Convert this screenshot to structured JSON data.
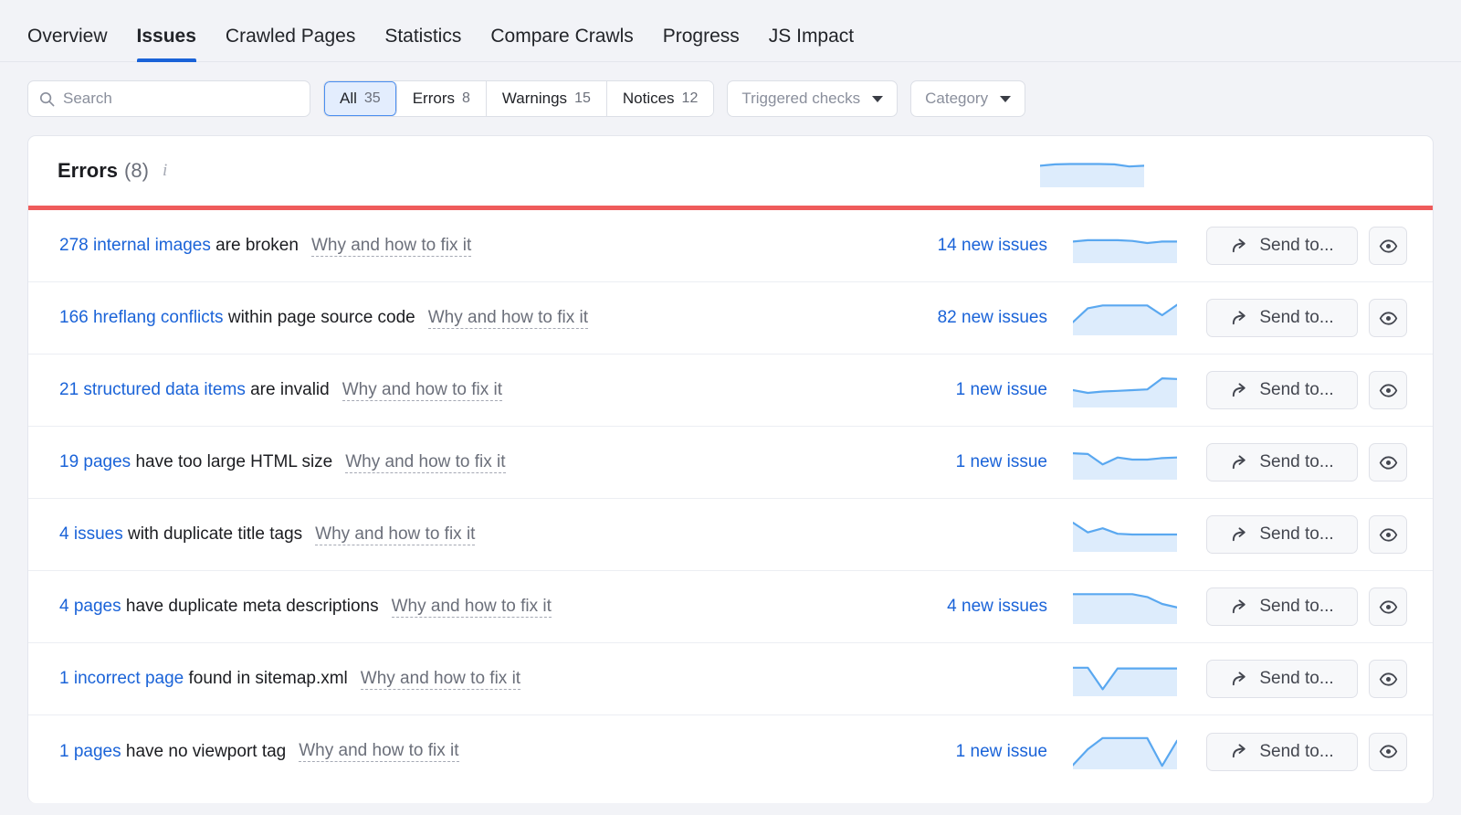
{
  "tabs": [
    {
      "label": "Overview",
      "active": false
    },
    {
      "label": "Issues",
      "active": true
    },
    {
      "label": "Crawled Pages",
      "active": false
    },
    {
      "label": "Statistics",
      "active": false
    },
    {
      "label": "Compare Crawls",
      "active": false
    },
    {
      "label": "Progress",
      "active": false
    },
    {
      "label": "JS Impact",
      "active": false
    }
  ],
  "search": {
    "value": "",
    "placeholder": "Search",
    "icon": "search-icon"
  },
  "segments": [
    {
      "label": "All",
      "count": "35",
      "active": true
    },
    {
      "label": "Errors",
      "count": "8",
      "active": false
    },
    {
      "label": "Warnings",
      "count": "15",
      "active": false
    },
    {
      "label": "Notices",
      "count": "12",
      "active": false
    }
  ],
  "dropdowns": [
    {
      "label": "Triggered checks",
      "icon": "chevron-down-icon"
    },
    {
      "label": "Category",
      "icon": "chevron-down-icon"
    }
  ],
  "card": {
    "title": "Errors",
    "count": "(8)",
    "info_icon": "info-icon",
    "severity_color": "#ef5b5b",
    "accent_color": "#1a63d8",
    "header_sparkline": [
      62,
      66,
      67,
      67,
      67,
      66,
      60,
      62
    ]
  },
  "row_actions": {
    "send_to_label": "Send to...",
    "send_to_icon": "share-arrow-icon",
    "visibility_icon": "eye-icon"
  },
  "rows": [
    {
      "count_link": "278 internal images",
      "rest": " are broken",
      "fix_label": "Why and how to fix it",
      "new_issues": "14 new issues",
      "sparkline": [
        62,
        66,
        66,
        66,
        64,
        58,
        62,
        62
      ]
    },
    {
      "count_link": "166 hreflang conflicts",
      "rest": " within page source code",
      "fix_label": "Why and how to fix it",
      "new_issues": "82 new issues",
      "sparkline": [
        38,
        78,
        86,
        86,
        86,
        86,
        58,
        88
      ]
    },
    {
      "count_link": "21 structured data items",
      "rest": " are invalid",
      "fix_label": "Why and how to fix it",
      "new_issues": "1 new issue",
      "sparkline": [
        50,
        42,
        46,
        48,
        50,
        52,
        84,
        82
      ]
    },
    {
      "count_link": "19 pages",
      "rest": " have too large HTML size",
      "fix_label": "Why and how to fix it",
      "new_issues": "1 new issue",
      "sparkline": [
        76,
        74,
        44,
        64,
        58,
        58,
        62,
        64
      ]
    },
    {
      "count_link": "4 issues",
      "rest": " with duplicate title tags",
      "fix_label": "Why and how to fix it",
      "new_issues": "",
      "sparkline": [
        84,
        56,
        68,
        52,
        50,
        50,
        50,
        50
      ]
    },
    {
      "count_link": "4 pages",
      "rest": " have duplicate meta descriptions",
      "fix_label": "Why and how to fix it",
      "new_issues": "4 new issues",
      "sparkline": [
        86,
        86,
        86,
        86,
        86,
        78,
        58,
        48
      ]
    },
    {
      "count_link": "1 incorrect page",
      "rest": " found in sitemap.xml",
      "fix_label": "Why and how to fix it",
      "new_issues": "",
      "sparkline": [
        82,
        82,
        20,
        80,
        80,
        80,
        80,
        80
      ]
    },
    {
      "count_link": "1 pages",
      "rest": " have no viewport tag",
      "fix_label": "Why and how to fix it",
      "new_issues": "1 new issue",
      "sparkline": [
        12,
        58,
        90,
        90,
        90,
        90,
        10,
        82
      ]
    }
  ]
}
